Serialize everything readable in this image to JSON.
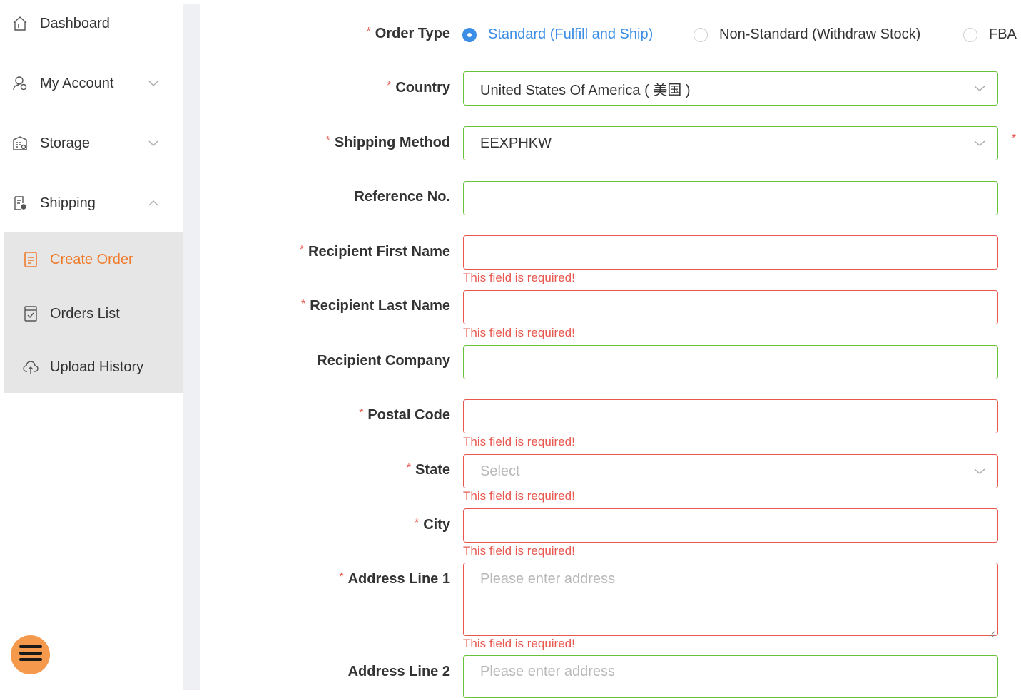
{
  "sidebar": {
    "items": [
      {
        "label": "Dashboard",
        "icon": "home-icon"
      },
      {
        "label": "My Account",
        "icon": "user-icon"
      },
      {
        "label": "Storage",
        "icon": "building-icon"
      },
      {
        "label": "Shipping",
        "icon": "document-icon"
      }
    ],
    "shipping_submenu": [
      {
        "label": "Create Order",
        "icon": "create-order-icon",
        "active": true
      },
      {
        "label": "Orders List",
        "icon": "checklist-icon"
      },
      {
        "label": "Upload History",
        "icon": "cloud-upload-icon"
      }
    ]
  },
  "form": {
    "order_type": {
      "label": "Order Type",
      "options": [
        {
          "label": "Standard (Fulfill and Ship)",
          "selected": true
        },
        {
          "label": "Non-Standard (Withdraw Stock)",
          "selected": false
        },
        {
          "label": "FBA",
          "selected": false
        }
      ]
    },
    "country": {
      "label": "Country",
      "value": "United States Of America ( 美国 )"
    },
    "shipping_method": {
      "label": "Shipping Method",
      "value": "EEXPHKW"
    },
    "reference_no": {
      "label": "Reference No.",
      "value": ""
    },
    "first_name": {
      "label": "Recipient First Name",
      "value": "",
      "error": "This field is required!"
    },
    "last_name": {
      "label": "Recipient Last Name",
      "value": "",
      "error": "This field is required!"
    },
    "company": {
      "label": "Recipient Company",
      "value": ""
    },
    "postal_code": {
      "label": "Postal Code",
      "value": "",
      "error": "This field is required!"
    },
    "state": {
      "label": "State",
      "placeholder": "Select",
      "error": "This field is required!"
    },
    "city": {
      "label": "City",
      "value": "",
      "error": "This field is required!"
    },
    "address1": {
      "label": "Address Line 1",
      "placeholder": "Please enter address",
      "error": "This field is required!"
    },
    "address2": {
      "label": "Address Line 2",
      "placeholder": "Please enter address"
    },
    "required_mark": "*"
  },
  "colors": {
    "accent": "#3a8ee6",
    "active_menu": "#f07b2a",
    "error": "#e8584f",
    "valid_border": "#67c23a",
    "fab": "#f59a4c"
  }
}
